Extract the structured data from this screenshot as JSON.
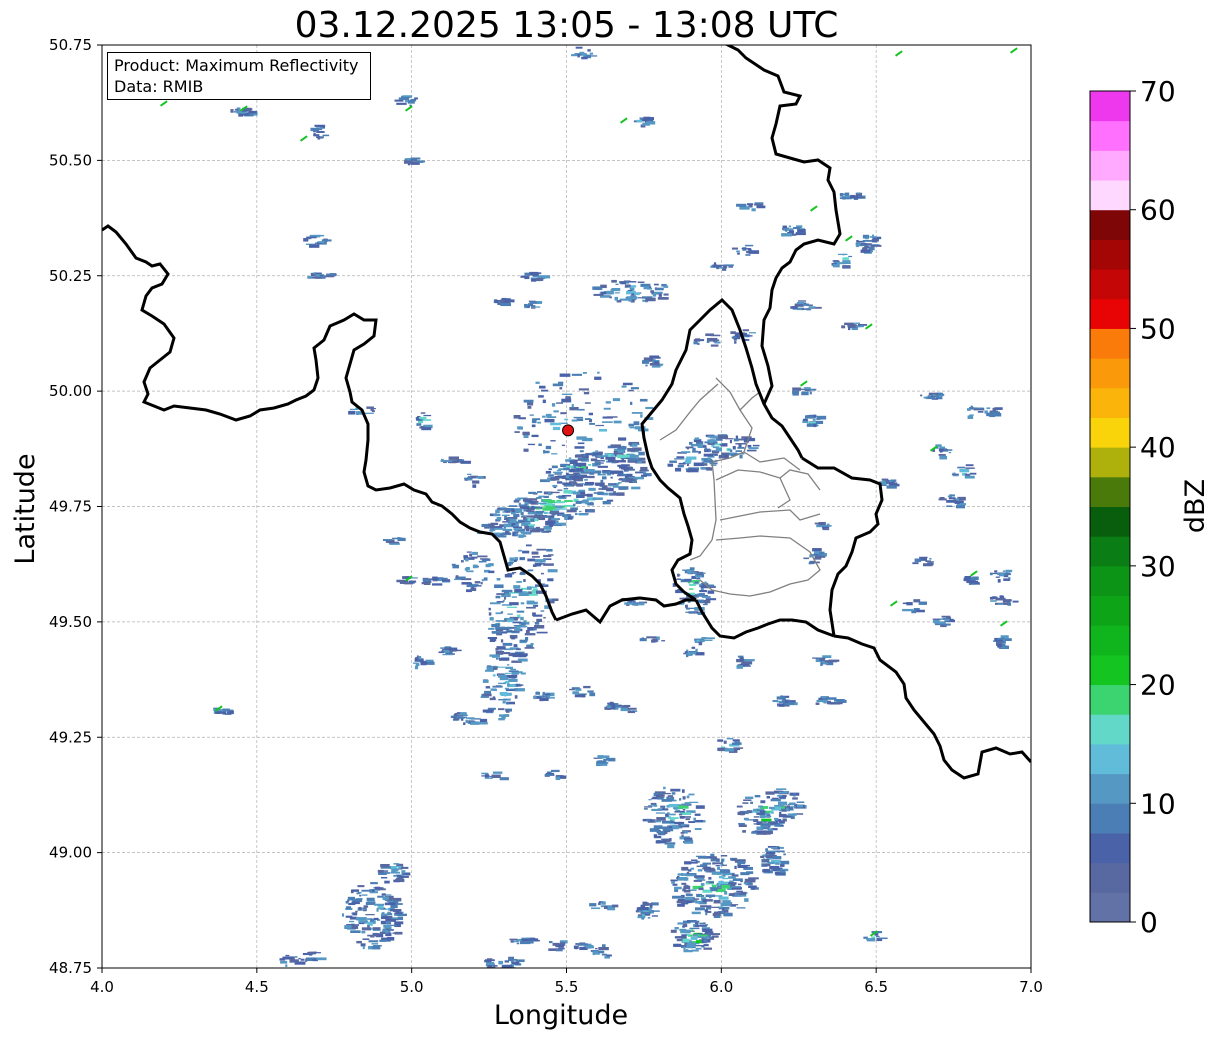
{
  "title": "03.12.2025 13:05 - 13:08 UTC",
  "info_box": {
    "line1": "Product: Maximum Reflectivity",
    "line2": "Data: RMIB"
  },
  "axes": {
    "xlabel": "Longitude",
    "ylabel": "Latitude",
    "xlim": [
      4.0,
      7.0
    ],
    "ylim": [
      48.75,
      50.75
    ],
    "xticks": [
      "4.0",
      "4.5",
      "5.0",
      "5.5",
      "6.0",
      "6.5",
      "7.0"
    ],
    "yticks": [
      "48.75",
      "49.00",
      "49.25",
      "49.50",
      "49.75",
      "50.00",
      "50.25",
      "50.50",
      "50.75"
    ],
    "grid": true
  },
  "colorbar": {
    "label": "dBZ",
    "range": [
      0,
      70
    ],
    "ticks": [
      "0",
      "10",
      "20",
      "30",
      "40",
      "50",
      "60",
      "70"
    ],
    "colors": [
      "#6272a6",
      "#5868a0",
      "#4a62a8",
      "#4a7eb4",
      "#5698c4",
      "#60bcd8",
      "#62d8c8",
      "#3cd470",
      "#14c420",
      "#10b41c",
      "#0ea418",
      "#0c9416",
      "#0a7e14",
      "#085e0c",
      "#4a7a0a",
      "#aeb00c",
      "#fad40a",
      "#fab40a",
      "#fa9a0a",
      "#fa7a0a",
      "#e80404",
      "#c40606",
      "#a40606",
      "#7e0606",
      "#ffd8ff",
      "#ffaaff",
      "#ff70ff",
      "#ee38ee"
    ]
  },
  "marker": {
    "lon": 5.505,
    "lat": 49.915,
    "color": "#e31212"
  },
  "colors": {
    "border_national": "#000000",
    "border_regional": "#808080",
    "grid": "#b0b0b0"
  }
}
